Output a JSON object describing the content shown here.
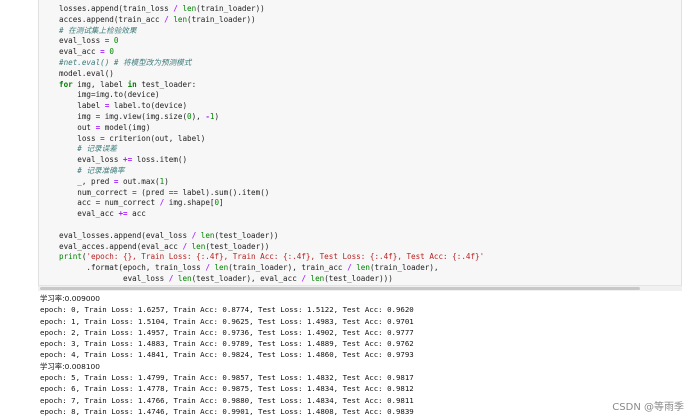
{
  "code": {
    "lines": [
      [
        [
          "",
          "losses.append(train_loss "
        ],
        [
          "op",
          "/"
        ],
        [
          "",
          " "
        ],
        [
          "bi",
          "len"
        ],
        [
          "",
          "(train_loader))"
        ]
      ],
      [
        [
          "",
          "acces.append(train_acc "
        ],
        [
          "op",
          "/"
        ],
        [
          "",
          " "
        ],
        [
          "bi",
          "len"
        ],
        [
          "",
          "(train_loader))"
        ]
      ],
      [
        [
          "cm",
          "# 在测试集上检验效果"
        ]
      ],
      [
        [
          "",
          "eval_loss "
        ],
        [
          "op",
          "="
        ],
        [
          "",
          " "
        ],
        [
          "num",
          "0"
        ]
      ],
      [
        [
          "",
          "eval_acc "
        ],
        [
          "op",
          "="
        ],
        [
          "",
          " "
        ],
        [
          "num",
          "0"
        ]
      ],
      [
        [
          "cm",
          "#net.eval() # 将模型改为预测模式"
        ]
      ],
      [
        [
          "",
          "model.eval()"
        ]
      ],
      [
        [
          "kw",
          "for"
        ],
        [
          "",
          " img, label "
        ],
        [
          "kw",
          "in"
        ],
        [
          "",
          " test_loader:"
        ]
      ],
      [
        [
          "",
          "    img"
        ],
        [
          "op",
          "="
        ],
        [
          "",
          "img.to(device)"
        ]
      ],
      [
        [
          "",
          "    label "
        ],
        [
          "op",
          "="
        ],
        [
          "",
          " label.to(device)"
        ]
      ],
      [
        [
          "",
          "    img "
        ],
        [
          "op",
          "="
        ],
        [
          "",
          " img.view(img.size("
        ],
        [
          "num",
          "0"
        ],
        [
          "",
          "), "
        ],
        [
          "op",
          "-"
        ],
        [
          "num",
          "1"
        ],
        [
          "",
          ")"
        ]
      ],
      [
        [
          "",
          "    out "
        ],
        [
          "op",
          "="
        ],
        [
          "",
          " model(img)"
        ]
      ],
      [
        [
          "",
          "    loss "
        ],
        [
          "op",
          "="
        ],
        [
          "",
          " criterion(out, label)"
        ]
      ],
      [
        [
          "",
          "    "
        ],
        [
          "cm",
          "# 记录误差"
        ]
      ],
      [
        [
          "",
          "    eval_loss "
        ],
        [
          "op",
          "+="
        ],
        [
          "",
          " loss.item()"
        ]
      ],
      [
        [
          "",
          "    "
        ],
        [
          "cm",
          "# 记录准确率"
        ]
      ],
      [
        [
          "",
          "    _, pred "
        ],
        [
          "op",
          "="
        ],
        [
          "",
          " out.max("
        ],
        [
          "num",
          "1"
        ],
        [
          "",
          ")"
        ]
      ],
      [
        [
          "",
          "    num_correct "
        ],
        [
          "op",
          "="
        ],
        [
          "",
          " (pred "
        ],
        [
          "op",
          "=="
        ],
        [
          "",
          " label).sum().item()"
        ]
      ],
      [
        [
          "",
          "    acc "
        ],
        [
          "op",
          "="
        ],
        [
          "",
          " num_correct "
        ],
        [
          "op",
          "/"
        ],
        [
          "",
          " img.shape["
        ],
        [
          "num",
          "0"
        ],
        [
          "",
          "]"
        ]
      ],
      [
        [
          "",
          "    eval_acc "
        ],
        [
          "op",
          "+="
        ],
        [
          "",
          " acc"
        ]
      ],
      [
        [
          "",
          ""
        ]
      ],
      [
        [
          "",
          "eval_losses.append(eval_loss "
        ],
        [
          "op",
          "/"
        ],
        [
          "",
          " "
        ],
        [
          "bi",
          "len"
        ],
        [
          "",
          "(test_loader))"
        ]
      ],
      [
        [
          "",
          "eval_acces.append(eval_acc "
        ],
        [
          "op",
          "/"
        ],
        [
          "",
          " "
        ],
        [
          "bi",
          "len"
        ],
        [
          "",
          "(test_loader))"
        ]
      ],
      [
        [
          "bi",
          "print"
        ],
        [
          "",
          "("
        ],
        [
          "str",
          "'epoch: {}, Train Loss: {:.4f}, Train Acc: {:.4f}, Test Loss: {:.4f}, Test Acc: {:.4f}'"
        ]
      ],
      [
        [
          "",
          "      .format(epoch, train_loss "
        ],
        [
          "op",
          "/"
        ],
        [
          "",
          " "
        ],
        [
          "bi",
          "len"
        ],
        [
          "",
          "(train_loader), train_acc "
        ],
        [
          "op",
          "/"
        ],
        [
          "",
          " "
        ],
        [
          "bi",
          "len"
        ],
        [
          "",
          "(train_loader),"
        ]
      ],
      [
        [
          "",
          "              eval_loss "
        ],
        [
          "op",
          "/"
        ],
        [
          "",
          " "
        ],
        [
          "bi",
          "len"
        ],
        [
          "",
          "(test_loader), eval_acc "
        ],
        [
          "op",
          "/"
        ],
        [
          "",
          " "
        ],
        [
          "bi",
          "len"
        ],
        [
          "",
          "(test_loader)))"
        ]
      ]
    ]
  },
  "output": {
    "lines": [
      "学习率:0.009000",
      "epoch: 0, Train Loss: 1.6257, Train Acc: 0.8774, Test Loss: 1.5122, Test Acc: 0.9620",
      "epoch: 1, Train Loss: 1.5104, Train Acc: 0.9625, Test Loss: 1.4983, Test Acc: 0.9701",
      "epoch: 2, Train Loss: 1.4957, Train Acc: 0.9736, Test Loss: 1.4902, Test Acc: 0.9777",
      "epoch: 3, Train Loss: 1.4883, Train Acc: 0.9789, Test Loss: 1.4889, Test Acc: 0.9762",
      "epoch: 4, Train Loss: 1.4841, Train Acc: 0.9824, Test Loss: 1.4860, Test Acc: 0.9793",
      "学习率:0.008100",
      "epoch: 5, Train Loss: 1.4799, Train Acc: 0.9857, Test Loss: 1.4832, Test Acc: 0.9817",
      "epoch: 6, Train Loss: 1.4778, Train Acc: 0.9875, Test Loss: 1.4834, Test Acc: 0.9812",
      "epoch: 7, Train Loss: 1.4766, Train Acc: 0.9880, Test Loss: 1.4834, Test Acc: 0.9811",
      "epoch: 8, Train Loss: 1.4746, Train Acc: 0.9901, Test Loss: 1.4808, Test Acc: 0.9839"
    ]
  },
  "watermark": "CSDN @等雨季",
  "colors": {
    "keyword": "#008000",
    "operator": "#aa22ff",
    "number": "#008800",
    "string": "#ba2121",
    "comment": "#3d7b7b",
    "cell_background": "#f7f7f7"
  }
}
